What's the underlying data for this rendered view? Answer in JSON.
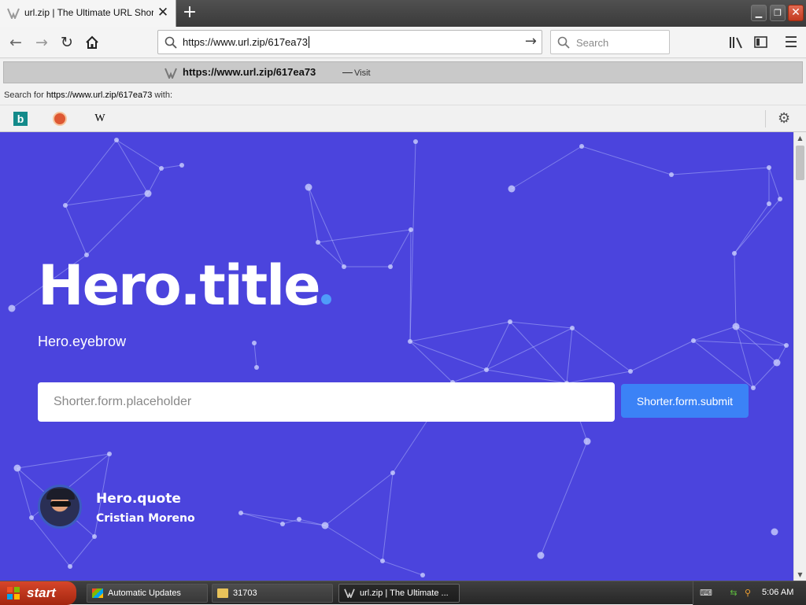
{
  "browser": {
    "tab": {
      "title": "url.zip | The Ultimate URL Shorten..."
    },
    "nav": {
      "url": "https://www.url.zip/617ea73",
      "search_placeholder": "Search"
    },
    "dropdown": {
      "suggestion_url": "https://www.url.zip/617ea73",
      "suggestion_dash": "—",
      "suggestion_action": "Visit",
      "search_prefix": "Search for ",
      "search_query": "https://www.url.zip/617ea73",
      "search_suffix": " with:",
      "engines": [
        {
          "name": "Bing",
          "icon": "bing-icon"
        },
        {
          "name": "DuckDuckGo",
          "icon": "duckduckgo-icon"
        },
        {
          "name": "Wikipedia",
          "icon": "wikipedia-icon",
          "glyph": "W"
        }
      ]
    }
  },
  "page": {
    "hero": {
      "title": "Hero.title",
      "eyebrow": "Hero.eyebrow",
      "quote": "Hero.quote",
      "author": "Cristian Moreno"
    },
    "shorter_form": {
      "placeholder": "Shorter.form.placeholder",
      "submit": "Shorter.form.submit"
    },
    "colors": {
      "background": "#4b44dd",
      "accent": "#3b82f6",
      "title_dot": "#4f9cf9"
    }
  },
  "taskbar": {
    "start": "start",
    "items": [
      {
        "label": "Automatic Updates",
        "icon": "windows-update-icon"
      },
      {
        "label": "31703",
        "icon": "folder-icon"
      },
      {
        "label": "url.zip | The Ultimate ...",
        "icon": "url-zip-icon",
        "active": true
      }
    ],
    "clock": "5:06 AM"
  }
}
